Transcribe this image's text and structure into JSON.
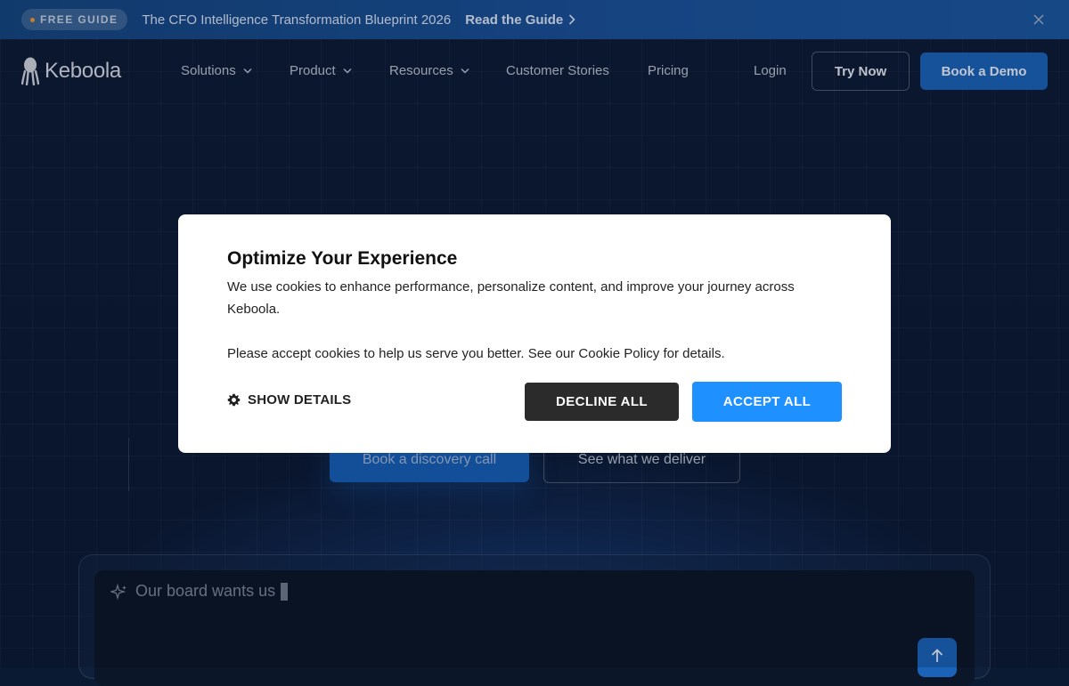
{
  "announcement": {
    "badge": "FREE GUIDE",
    "title": "The CFO Intelligence Transformation Blueprint 2026",
    "link": "Read the Guide"
  },
  "nav": {
    "logo": "Keboola",
    "items": [
      {
        "label": "Solutions",
        "has_dropdown": true
      },
      {
        "label": "Product",
        "has_dropdown": true
      },
      {
        "label": "Resources",
        "has_dropdown": true
      },
      {
        "label": "Customer Stories",
        "has_dropdown": false
      },
      {
        "label": "Pricing",
        "has_dropdown": false
      }
    ],
    "login": "Login",
    "try_now": "Try Now",
    "book_demo": "Book a Demo"
  },
  "hero": {
    "cta_primary": "Book a discovery call",
    "cta_secondary": "See what we deliver"
  },
  "prompt": {
    "text": "Our board wants us"
  },
  "cookie_modal": {
    "title": "Optimize Your Experience",
    "body": "We use cookies to enhance performance, personalize content, and improve your journey across Keboola.",
    "body2": "Please accept cookies to help us serve you better. See our Cookie Policy for details.",
    "show_details": "SHOW DETAILS",
    "decline": "DECLINE ALL",
    "accept": "ACCEPT ALL"
  },
  "colors": {
    "accent_blue": "#1e90ff",
    "brand_blue": "#1a63b8",
    "decline_dark": "#2b2b2b",
    "badge_dot": "#f29a2e"
  }
}
